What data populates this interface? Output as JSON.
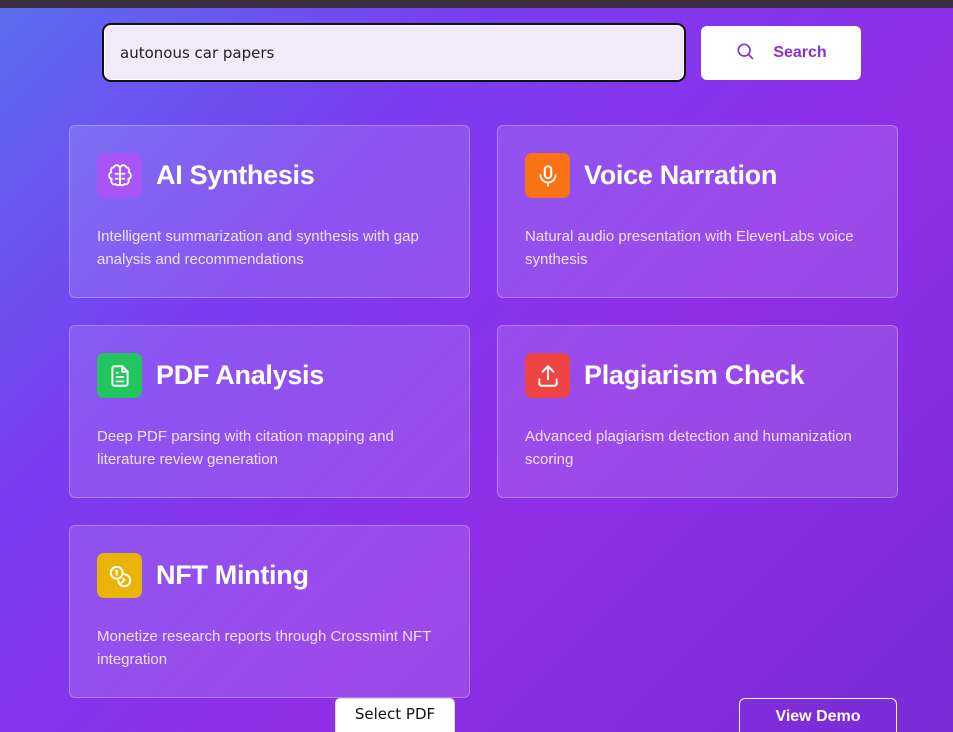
{
  "search": {
    "value": "autonous car papers",
    "button_label": "Search"
  },
  "features": [
    {
      "title": "AI Synthesis",
      "description": "Intelligent summarization and synthesis with gap analysis and recommendations",
      "icon": "brain-icon",
      "color": "#a855f7"
    },
    {
      "title": "Voice Narration",
      "description": "Natural audio presentation with ElevenLabs voice synthesis",
      "icon": "microphone-icon",
      "color": "#f97316"
    },
    {
      "title": "PDF Analysis",
      "description": "Deep PDF parsing with citation mapping and literature review generation",
      "icon": "document-icon",
      "color": "#22c55e"
    },
    {
      "title": "Plagiarism Check",
      "description": "Advanced plagiarism detection and humanization scoring",
      "icon": "upload-icon",
      "color": "#ef4444"
    },
    {
      "title": "NFT Minting",
      "description": "Monetize research reports through Crossmint NFT integration",
      "icon": "coins-icon",
      "color": "#eab308"
    }
  ],
  "actions": {
    "select_pdf_label": "Select PDF",
    "view_demo_label": "View Demo"
  }
}
